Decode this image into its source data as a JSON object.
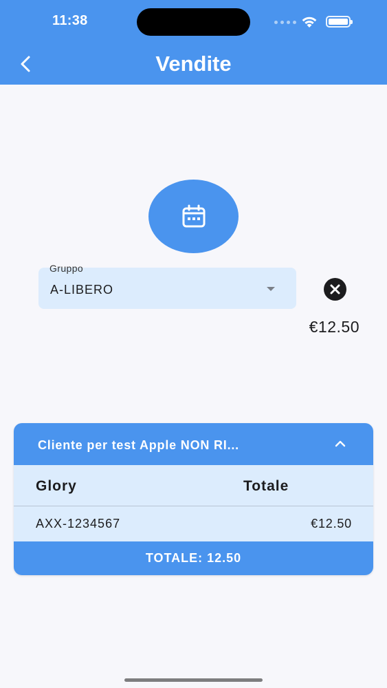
{
  "status_bar": {
    "time": "11:38"
  },
  "header": {
    "title": "Vendite",
    "back_icon": "chevron-left-icon"
  },
  "calendar": {
    "icon": "calendar-icon"
  },
  "gruppo": {
    "label": "Gruppo",
    "value": "A-LIBERO",
    "dropdown_icon": "arrow-drop-down-icon"
  },
  "clear": {
    "icon": "close-circle-icon"
  },
  "amount": "€12.50",
  "card": {
    "title": "Cliente per test Apple NON RI...",
    "collapse_icon": "chevron-up-icon",
    "columns": [
      "Glory",
      "Totale"
    ],
    "rows": [
      {
        "code": "AXX-1234567",
        "amount": "€12.50"
      }
    ],
    "footer": "TOTALE: 12.50"
  },
  "colors": {
    "accent": "#4a94ee",
    "field_bg": "#dcecfd",
    "background": "#f7f7fb"
  }
}
